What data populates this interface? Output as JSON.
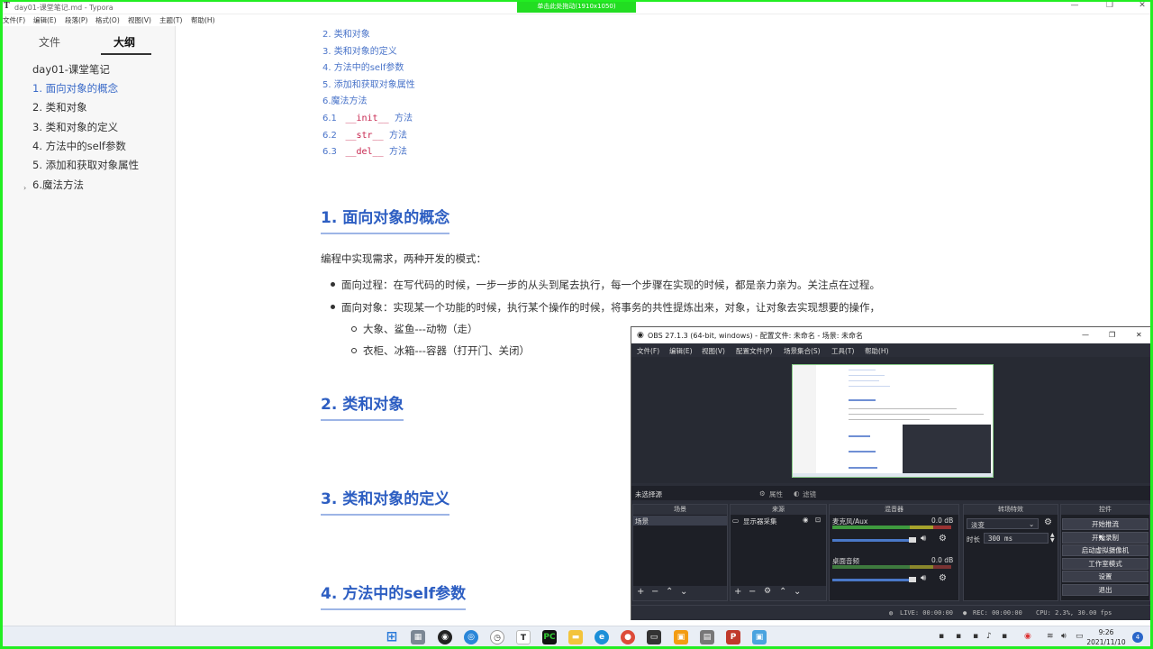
{
  "window": {
    "title": "day01-课堂笔记.md - Typora",
    "app_icon_letter": "T",
    "minimize": "—",
    "maximize": "❐",
    "close": "✕",
    "capture_banner": "单击此处拖动(1910x1050)"
  },
  "menu": [
    "文件(F)",
    "编辑(E)",
    "段落(P)",
    "格式(O)",
    "视图(V)",
    "主题(T)",
    "帮助(H)"
  ],
  "sidebar": {
    "tabs": [
      "文件",
      "大纲"
    ],
    "outline": [
      "day01-课堂笔记",
      "1. 面向对象的概念",
      "2. 类和对象",
      "3. 类和对象的定义",
      "4. 方法中的self参数",
      "5. 添加和获取对象属性",
      "6.魔法方法"
    ],
    "caret": "›",
    "footer_left": "‹",
    "footer_right": "</>"
  },
  "editor": {
    "toc": [
      "2. 类和对象",
      "3. 类和对象的定义",
      "4. 方法中的self参数",
      "5. 添加和获取对象属性",
      "6.魔法方法"
    ],
    "toc_sub": [
      {
        "num": "6.1",
        "code": "__init__",
        "text": "方法"
      },
      {
        "num": "6.2",
        "code": "__str__",
        "text": "方法"
      },
      {
        "num": "6.3",
        "code": "__del__",
        "text": "方法"
      }
    ],
    "h_1": "1. 面向对象的概念",
    "intro": "编程中实现需求，两种开发的模式：",
    "bullet_1": "面向过程：在写代码的时候，一步一步的从头到尾去执行，每一个步骤在实现的时候，都是亲力亲为。关注点在过程。",
    "bullet_2": "面向对象：实现某一个功能的时候，执行某个操作的时候，将事务的共性提炼出来，对象，让对象去实现想要的操作，",
    "sub_1": "大象、鲨鱼---动物（走）",
    "sub_2": "衣柜、冰箱---容器（打开门、关闭）",
    "h_2": "2. 类和对象",
    "h_3": "3. 类和对象的定义",
    "h_4": "4. 方法中的self参数"
  },
  "obs": {
    "title": "OBS 27.1.3 (64-bit, windows) - 配置文件: 未命名 - 场景: 未命名",
    "menu": [
      "文件(F)",
      "编辑(E)",
      "视图(V)",
      "配置文件(P)",
      "场景集合(S)",
      "工具(T)",
      "帮助(H)"
    ],
    "no_source": "未选择源",
    "properties": "属性",
    "filters": "滤镜",
    "panels": {
      "scenes": "场景",
      "sources": "来源",
      "mixer": "混音器",
      "transitions": "转场特效",
      "controls": "控件"
    },
    "scene_item": "场景",
    "source_item": "显示器采集",
    "mixer_ch1": "麦克风/Aux",
    "mixer_ch1_db": "0.0 dB",
    "mixer_ch2": "桌面音频",
    "mixer_ch2_db": "0.0 dB",
    "transition": "淡变",
    "duration_label": "时长",
    "duration_value": "300 ms",
    "buttons": [
      "开始推流",
      "开始录制",
      "启动虚拟摄像机",
      "工作室模式",
      "设置",
      "退出"
    ],
    "status": {
      "live": "LIVE: 00:00:00",
      "rec": "REC: 00:00:00",
      "cpu": "CPU: 2.3%, 30.00 fps"
    }
  },
  "taskbar": {
    "time": "9:26",
    "date": "2021/11/10",
    "notifications": "4"
  },
  "colors": {
    "heading_blue": "#2d5ec2",
    "link_blue": "#4a74c9",
    "code_red": "#c7254e",
    "capture_green": "#22ee22",
    "obs_bg": "#2b2e38"
  }
}
